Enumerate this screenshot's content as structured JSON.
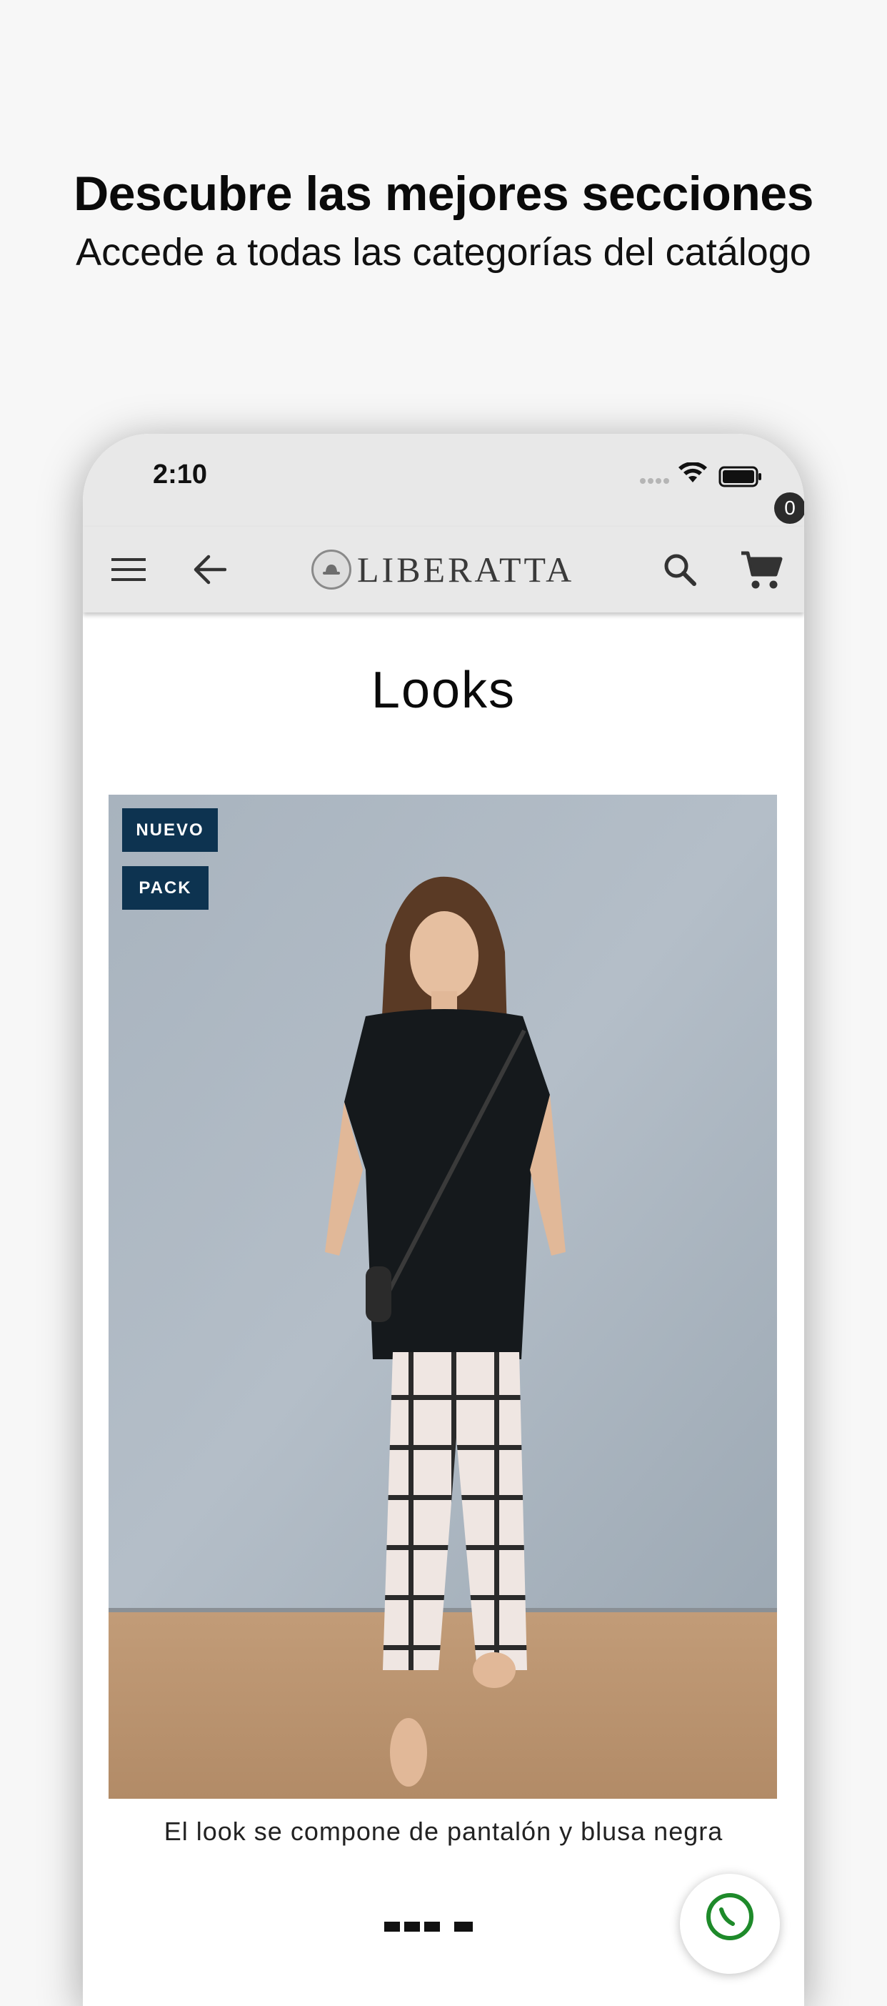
{
  "promo": {
    "title": "Descubre las mejores secciones",
    "subtitle": "Accede a todas las categorías del catálogo"
  },
  "status_bar": {
    "time": "2:10",
    "icons": [
      "signal-dots-icon",
      "wifi-icon",
      "battery-icon"
    ]
  },
  "app_bar": {
    "icons": [
      "menu-icon",
      "back-arrow-icon",
      "search-icon",
      "cart-icon"
    ],
    "logo_text": "LIBERATTA",
    "cart_count": "0"
  },
  "page": {
    "heading": "Looks"
  },
  "product": {
    "tags": [
      "NUEVO",
      "PACK"
    ],
    "caption": "El look se compone de pantalón y blusa negra"
  },
  "colors": {
    "tag_background": "#0d3350",
    "app_bar_background": "#e8e8e8",
    "whatsapp_green": "#1e8a2a"
  }
}
